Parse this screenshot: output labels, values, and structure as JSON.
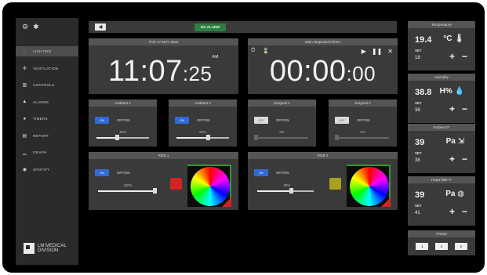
{
  "sidebar": {
    "top_icons": [
      "gear-icon",
      "bug-icon"
    ],
    "items": [
      {
        "icon": "lightbulb-icon",
        "label": "LIGHTING",
        "active": true
      },
      {
        "icon": "fan-icon",
        "label": "VENTILATION"
      },
      {
        "icon": "controls-icon",
        "label": "CONTROLS"
      },
      {
        "icon": "warning-icon",
        "label": "ALARMS"
      },
      {
        "icon": "timer-icon",
        "label": "TIMERS"
      },
      {
        "icon": "report-icon",
        "label": "REPORT"
      },
      {
        "icon": "chart-icon",
        "label": "GRAPH"
      },
      {
        "icon": "spotify-icon",
        "label": "SPOTIFY"
      }
    ],
    "logo_text": "LM MEDICAL DIVISION"
  },
  "topbar": {
    "alarm_status": "NO ALARM"
  },
  "clock": {
    "date": "TUE 17 MAY 2022",
    "hours_minutes": "11:07",
    "seconds": ":25",
    "ampm": "AM"
  },
  "stopwatch": {
    "title": "Main Stopwatch/Timer",
    "hours_minutes": "00:00",
    "seconds": ":00"
  },
  "lights": {
    "ambient1": {
      "title": "Ambient 1",
      "toggle": "ON",
      "label": "OFF/ON",
      "percent": "40%",
      "level": 0.4,
      "on": true
    },
    "ambient2": {
      "title": "Ambient 2",
      "toggle": "ON",
      "label": "OFF/ON",
      "percent": "60%",
      "level": 0.6,
      "on": true
    },
    "surgical1": {
      "title": "Surgical 1",
      "toggle": "OFF",
      "label": "OFF/ON",
      "percent": "0%",
      "level": 0.0,
      "on": false
    },
    "surgical2": {
      "title": "Surgical 2",
      "toggle": "OFF",
      "label": "OFF/ON",
      "percent": "0%",
      "level": 0.0,
      "on": false
    }
  },
  "rgb": {
    "rgb1": {
      "title": "RGB 1",
      "toggle": "ON",
      "label": "OFF/ON",
      "percent": "100%",
      "level": 1.0,
      "color": "#d42323"
    },
    "rgb2": {
      "title": "RGB 2",
      "toggle": "ON",
      "label": "OFF/ON",
      "percent": "60%",
      "level": 0.6,
      "color": "#a8a01e"
    }
  },
  "sensors": {
    "temperature": {
      "title": "Temperature",
      "value": "19.4",
      "unit": "°C",
      "set_label": "SET",
      "set_value": "18",
      "icon": "thermometer-icon"
    },
    "humidity": {
      "title": "Humidity",
      "value": "38.8",
      "unit": "H%",
      "set_label": "SET",
      "set_value": "38",
      "icon": "drop-icon"
    },
    "ambient_p": {
      "title": "Ambient P.",
      "value": "39",
      "unit": "Pa",
      "set_label": "SET",
      "set_value": "38",
      "icon": "exit-icon"
    },
    "hepa_filter": {
      "title": "Hepa filter P.",
      "value": "39",
      "unit": "Pa",
      "set_label": "SET",
      "set_value": "41",
      "icon": "filter-icon"
    }
  },
  "preset": {
    "title": "Preset",
    "buttons": [
      "1",
      "2",
      "3"
    ]
  },
  "colors": {
    "bg": "#000000",
    "panel": "#3a3a3a",
    "header": "#555555",
    "toggle_on": "#2f6bd6",
    "alarm_ok": "#2f7d3f"
  }
}
